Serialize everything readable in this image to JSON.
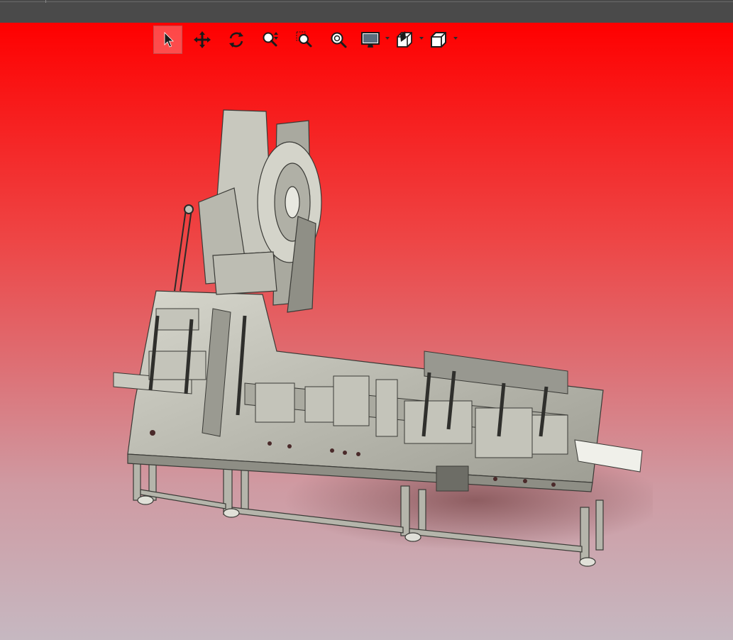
{
  "window": {
    "background_gradient": [
      "#ff0000",
      "#c6b8c1"
    ]
  },
  "toolbar": {
    "items": [
      {
        "name": "select-tool",
        "icon": "arrow-pointer-icon",
        "active": true
      },
      {
        "name": "pan-tool",
        "icon": "move-arrows-icon"
      },
      {
        "name": "rotate-tool",
        "icon": "rotate-icon"
      },
      {
        "name": "zoom-in-out-tool",
        "icon": "zoom-updown-icon"
      },
      {
        "name": "zoom-area-tool",
        "icon": "zoom-area-icon"
      },
      {
        "name": "zoom-fit-tool",
        "icon": "zoom-fit-icon"
      },
      {
        "name": "display-style-menu",
        "icon": "monitor-icon",
        "dropdown": true
      },
      {
        "name": "section-view-menu",
        "icon": "section-cube-icon",
        "dropdown": true
      },
      {
        "name": "view-orientation-menu",
        "icon": "cube-icon",
        "dropdown": true
      }
    ]
  },
  "model": {
    "name": "assembly-machine-3d-model"
  }
}
